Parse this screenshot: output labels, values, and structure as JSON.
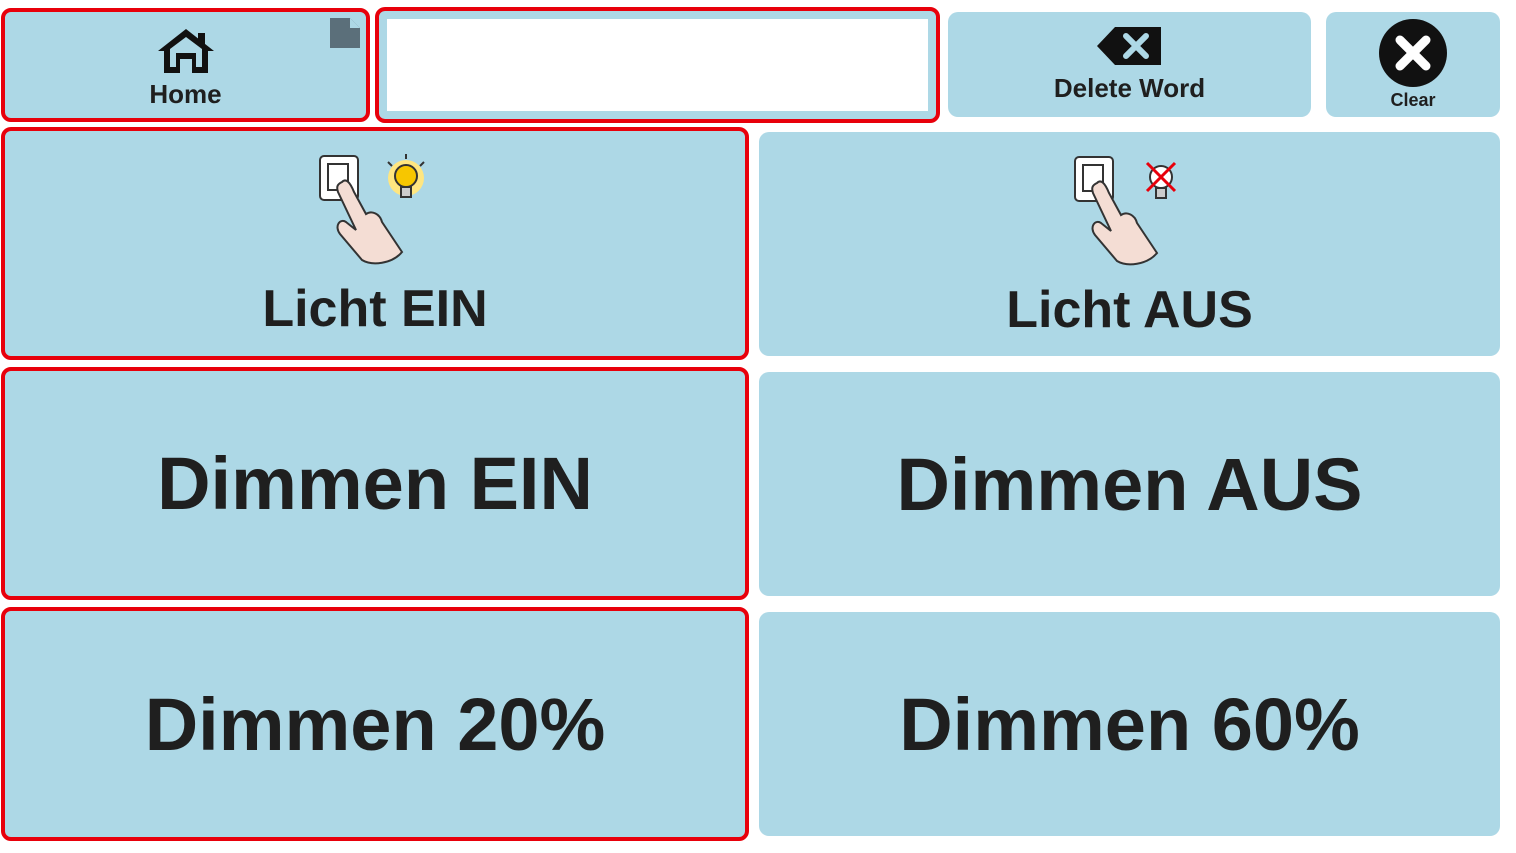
{
  "toolbar": {
    "home_label": "Home",
    "delete_word_label": "Delete Word",
    "clear_label": "Clear",
    "message_bar_value": ""
  },
  "grid": {
    "cells": [
      {
        "label": "Licht EIN",
        "icon": "light-switch-on-icon"
      },
      {
        "label": "Licht AUS",
        "icon": "light-switch-off-icon"
      },
      {
        "label": "Dimmen EIN"
      },
      {
        "label": "Dimmen AUS"
      },
      {
        "label": "Dimmen 20%"
      },
      {
        "label": "Dimmen 60%"
      }
    ]
  },
  "colors": {
    "cell_background": "#add8e6",
    "highlight_border": "#e8000b",
    "text": "#1f1f1f"
  }
}
